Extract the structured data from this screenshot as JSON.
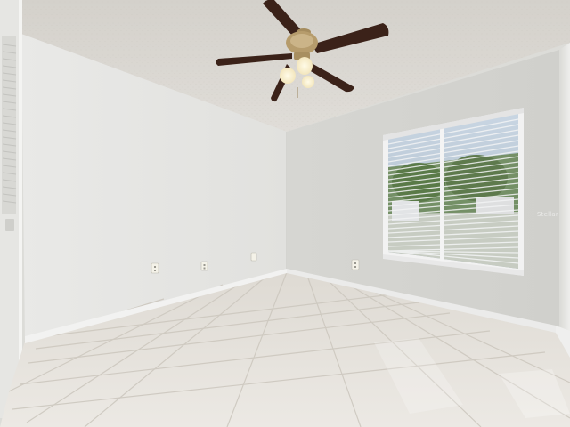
{
  "scene": {
    "kind": "photo-empty-bedroom",
    "colors": {
      "ceiling": "#d9d6d0",
      "left_wall": "#e6e6e4",
      "back_wall": "#dadad6",
      "right_wall": "#e3e3e0",
      "floor_tile": "#e4e1db",
      "grout": "#cfcac2",
      "baseboard": "#ebebea",
      "fan_blade": "#3a2219",
      "fan_brass": "#b49a6a",
      "window_frame": "#f2f2f2",
      "blind_slat": "#e9ecef",
      "outdoor_sky": "#b7c8d8",
      "outdoor_tree": "#5e7a4d"
    }
  },
  "watermark": "Stellar"
}
